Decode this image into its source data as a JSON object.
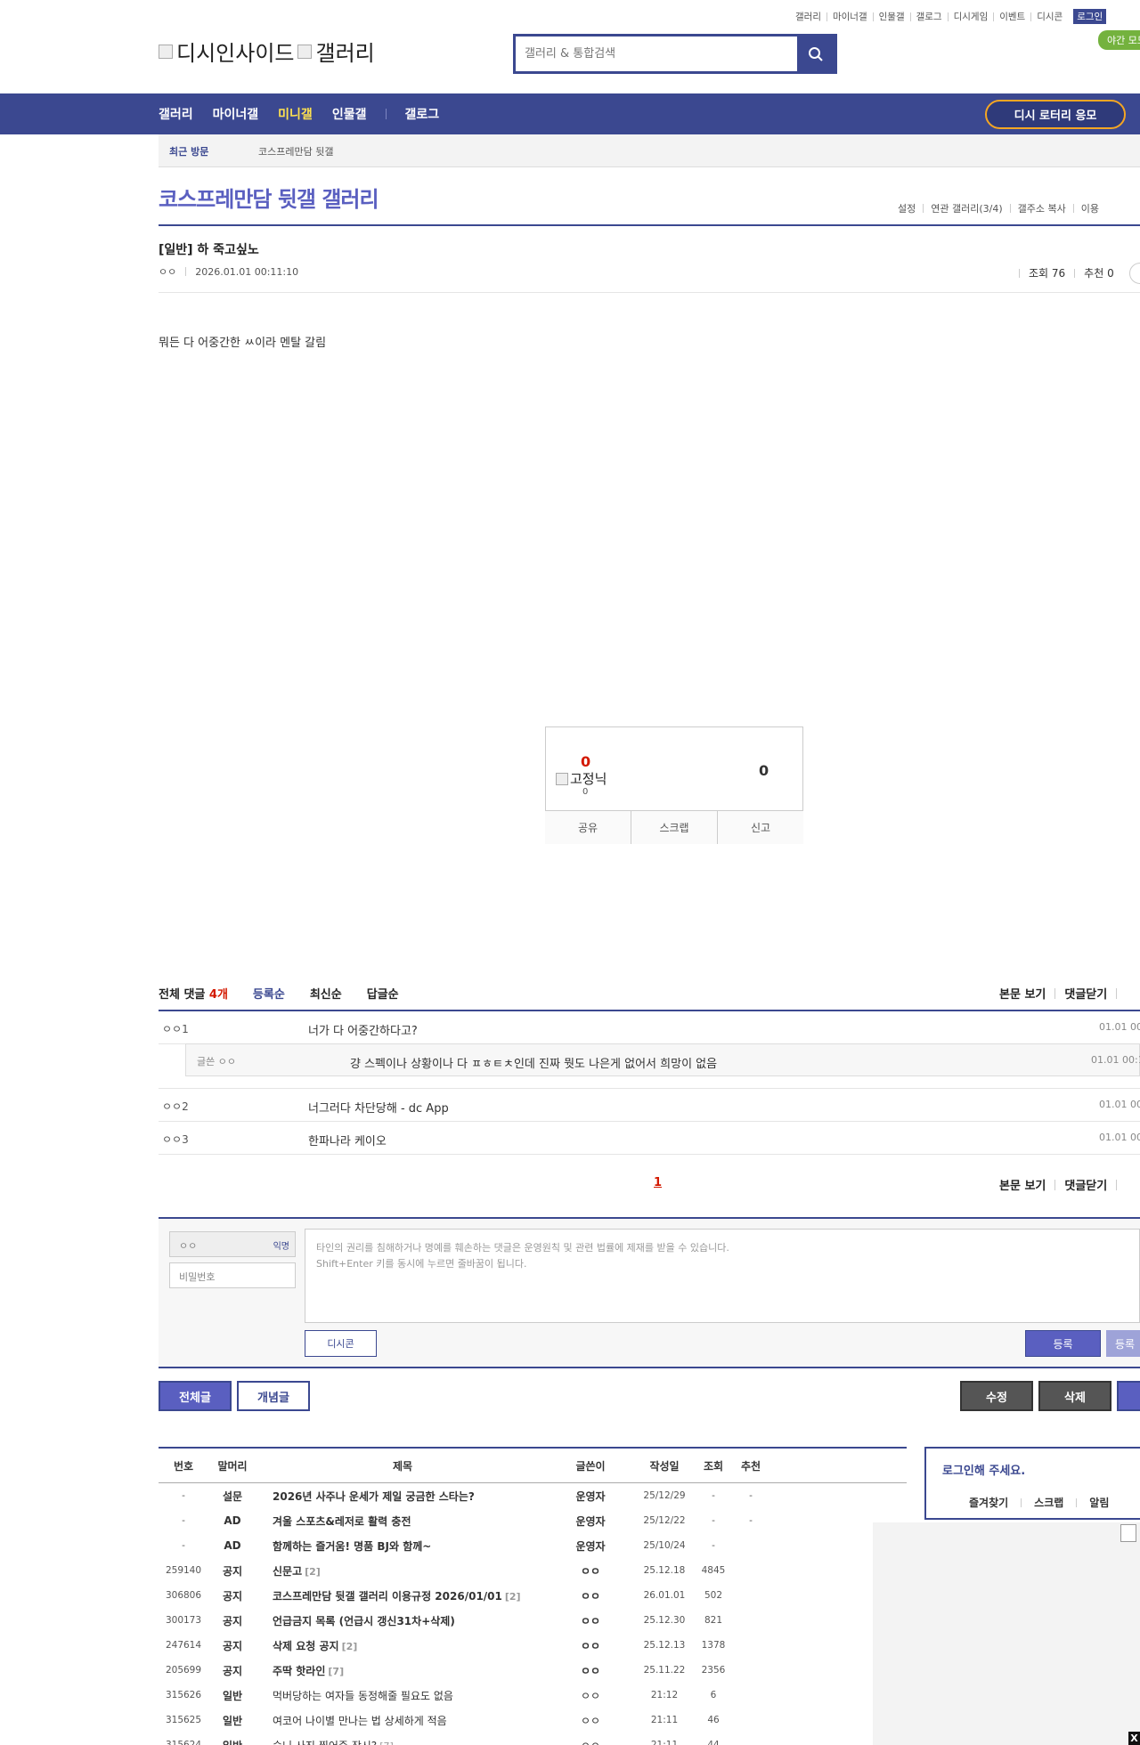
{
  "top_links": [
    "갤러리",
    "마이너갤",
    "인물갤",
    "갤로그",
    "디시게임",
    "이벤트",
    "디시콘"
  ],
  "login_label": "로그인",
  "night_mode_label": "야간 모드",
  "logo": {
    "site": "디시인사이드",
    "section": "갤러리"
  },
  "search": {
    "placeholder": "갤러리 & 통합검색"
  },
  "nav": {
    "items": [
      "갤러리",
      "마이너갤",
      "미니갤",
      "인물갤",
      "갤로그"
    ],
    "active": "미니갤",
    "lottery": "디시 로터리 응모"
  },
  "recent": {
    "label": "최근 방문",
    "items": [
      "코스프레만담 뒷갤"
    ]
  },
  "gallery": {
    "title": "코스프레만담 뒷갤 갤러리",
    "links": [
      "설정",
      "연관 갤러리(3/4)",
      "갤주소 복사",
      "이용"
    ]
  },
  "post": {
    "title": "[일반] 하 죽고싶노",
    "author": "ㅇㅇ",
    "datetime": "2026.01.01 00:11:10",
    "views_label": "조회 76",
    "recommend_label": "추천 0",
    "body": "뭐든 다 어중간한 ㅆ이라 멘탈 갈림"
  },
  "recommend": {
    "up": "0",
    "fixed_label": "고정닉",
    "fixed_count": "0",
    "down": "0",
    "actions": [
      "공유",
      "스크랩",
      "신고"
    ]
  },
  "comments": {
    "total_label": "전체 댓글",
    "count": "4개",
    "sorts": [
      "등록순",
      "최신순",
      "답글순"
    ],
    "right_links": [
      "본문 보기",
      "댓글닫기"
    ],
    "items": [
      {
        "nick": "ㅇㅇ1",
        "text": "너가 다 어중간하다고?",
        "time": "01.01 00:"
      },
      {
        "nick": "ㅇㅇ2",
        "text": "너그러다 차단당해 - dc App",
        "time": "01.01 00:"
      },
      {
        "nick": "ㅇㅇ3",
        "text": "한파나라 케이오",
        "time": "01.01 00:"
      }
    ],
    "reply": {
      "nick": "글쓴 ㅇㅇ",
      "text": "걍 스펙이나 상황이나 다 ㅍㅎㅌㅊ인데 진짜 뭣도 나은게 없어서 희망이 없음",
      "time": "01.01 00:1"
    },
    "page": "1"
  },
  "write": {
    "nick_value": "ㅇㅇ",
    "anon_tag": "익명",
    "password_placeholder": "비밀번호",
    "textarea_line1": "타인의 권리를 침해하거나 명예를 훼손하는 댓글은 운영원칙 및 관련 법률에 제재를 받을 수 있습니다.",
    "textarea_line2": "Shift+Enter 키를 동시에 누르면 줄바꿈이 됩니다.",
    "dccon": "디시콘",
    "register": "등록",
    "register2": "등록"
  },
  "buttons": {
    "all": "전체글",
    "concept": "개념글",
    "edit": "수정",
    "delete": "삭제"
  },
  "list": {
    "headers": [
      "번호",
      "말머리",
      "제목",
      "글쓴이",
      "작성일",
      "조회",
      "추천"
    ],
    "rows": [
      {
        "num": "-",
        "head": "설문",
        "title": "2026년 사주나 운세가 제일 궁금한 스타는?",
        "replies": "",
        "writer": "운영자",
        "date": "25/12/29",
        "views": "-",
        "rec": "-",
        "bold": true
      },
      {
        "num": "-",
        "head": "AD",
        "title": "겨울 스포츠&레저로 활력 충전",
        "replies": "",
        "writer": "운영자",
        "date": "25/12/22",
        "views": "-",
        "rec": "-",
        "bold": true
      },
      {
        "num": "-",
        "head": "AD",
        "title": "함께하는 즐거움! 명품 BJ와 함께~",
        "replies": "",
        "writer": "운영자",
        "date": "25/10/24",
        "views": "-",
        "rec": "",
        "bold": true
      },
      {
        "num": "259140",
        "head": "공지",
        "title": "신문고",
        "replies": "[2]",
        "writer": "ㅇㅇ",
        "date": "25.12.18",
        "views": "4845",
        "rec": "",
        "bold": true
      },
      {
        "num": "306806",
        "head": "공지",
        "title": "코스프레만담 뒷갤 갤러리 이용규정 2026/01/01",
        "replies": "[2]",
        "writer": "ㅇㅇ",
        "date": "26.01.01",
        "views": "502",
        "rec": "",
        "bold": true
      },
      {
        "num": "300173",
        "head": "공지",
        "title": "언급금지 목록 (언급시 갱신31차+삭제)",
        "replies": "",
        "writer": "ㅇㅇ",
        "date": "25.12.30",
        "views": "821",
        "rec": "",
        "bold": true
      },
      {
        "num": "247614",
        "head": "공지",
        "title": "삭제 요청 공지",
        "replies": "[2]",
        "writer": "ㅇㅇ",
        "date": "25.12.13",
        "views": "1378",
        "rec": "",
        "bold": true
      },
      {
        "num": "205699",
        "head": "공지",
        "title": "주딱 핫라인",
        "replies": "[7]",
        "writer": "ㅇㅇ",
        "date": "25.11.22",
        "views": "2356",
        "rec": "",
        "bold": true
      },
      {
        "num": "315626",
        "head": "일반",
        "title": "먹버당하는 여자들 동정해줄 필요도 없음",
        "replies": "",
        "writer": "ㅇㅇ",
        "date": "21:12",
        "views": "6",
        "rec": "",
        "bold": false
      },
      {
        "num": "315625",
        "head": "일반",
        "title": "여코어 나이별 만나는 법 상세하게 적음",
        "replies": "",
        "writer": "ㅇㅇ",
        "date": "21:11",
        "views": "46",
        "rec": "",
        "bold": false
      },
      {
        "num": "315624",
        "head": "일반",
        "title": "승니 사진 찍어준 작시?",
        "replies": "[7]",
        "writer": "ㅇㅇ",
        "date": "21:11",
        "views": "44",
        "rec": "",
        "bold": false
      }
    ]
  },
  "side": {
    "login_prompt": "로그인해 주세요.",
    "links": [
      "즐겨찾기",
      "스크랩",
      "알림"
    ]
  },
  "close_label": "X"
}
